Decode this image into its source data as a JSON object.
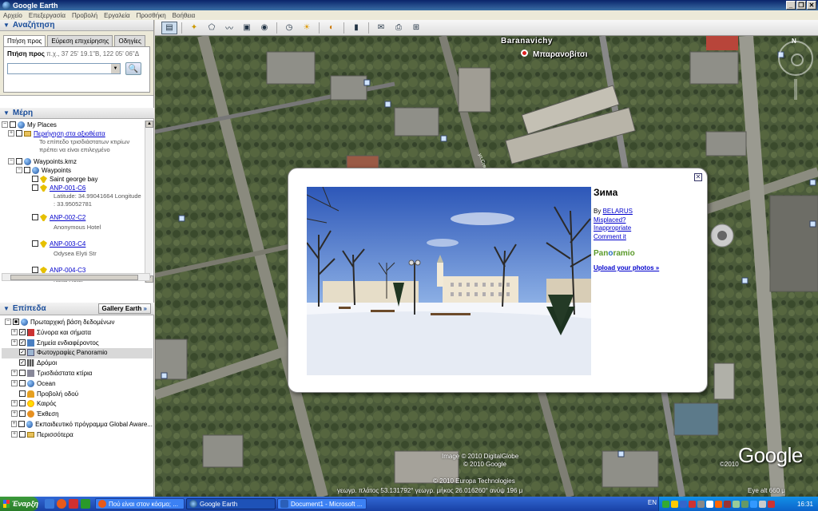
{
  "window": {
    "title": "Google Earth",
    "buttons": [
      "_",
      "❐",
      "✕"
    ]
  },
  "menu": [
    "Αρχείο",
    "Επεξεργασία",
    "Προβολή",
    "Εργαλεία",
    "Προσθήκη",
    "Βοήθεια"
  ],
  "search": {
    "header": "Αναζήτηση",
    "tabs": [
      "Πτήση προς",
      "Εύρεση επιχείρησης",
      "Οδηγίες"
    ],
    "fly_label": "Πτήση προς",
    "fly_hint": "π.χ., 37 25' 19.1\"Β, 122 05' 06\"Δ",
    "input_value": ""
  },
  "places": {
    "header": "Μέρη",
    "items": {
      "my_places": "My Places",
      "tour_link": "Περιήγηση στα αξιοθέατα",
      "tour_desc1": "Το επίπεδο τρισδιάστατων κτιρίων",
      "tour_desc2": "πρέπει να είναι επιλεγμένο",
      "kmz": "Waypoints.kmz",
      "waypoints": "Waypoints",
      "saint_george": "Saint george bay",
      "anp1": "ANP-001-C6",
      "anp1_desc1": "Latitude: 34.99041664 Longitude",
      "anp1_desc2": ": 33.95052781",
      "anp2": "ANP-002-C2",
      "anp2_desc": "Anonymous Hotel",
      "anp3": "ANP-003-C4",
      "anp3_desc": "Odysea Elyti Str",
      "anp4": "ANP-004-C3",
      "anp4_desc": "Nelia Hotel"
    }
  },
  "layers": {
    "header": "Επίπεδα",
    "gallery": "Gallery Earth",
    "items": [
      {
        "label": "Πρωταρχική βάση δεδομένων",
        "icon": "globe",
        "checked": "■",
        "exp": "−",
        "indent": 0
      },
      {
        "label": "Σύνορα και σήματα",
        "icon": "flag",
        "checked": "✓",
        "exp": "+",
        "indent": 1
      },
      {
        "label": "Σημεία ενδιαφέροντος",
        "icon": "blue",
        "checked": "✓",
        "exp": "+",
        "indent": 1
      },
      {
        "label": "Φωτογραφίες Panoramio",
        "icon": "photo",
        "checked": "✓",
        "exp": "",
        "indent": 1
      },
      {
        "label": "Δρόμοι",
        "icon": "road",
        "checked": "✓",
        "exp": "",
        "indent": 1
      },
      {
        "label": "Τρισδιάστατα κτίρια",
        "icon": "building",
        "checked": "",
        "exp": "+",
        "indent": 1
      },
      {
        "label": "Ocean",
        "icon": "globe",
        "checked": "",
        "exp": "+",
        "indent": 1
      },
      {
        "label": "Προβολή οδού",
        "icon": "person",
        "checked": "",
        "exp": "",
        "indent": 1
      },
      {
        "label": "Καιρός",
        "icon": "sun",
        "checked": "",
        "exp": "+",
        "indent": 1
      },
      {
        "label": "Έκθεση",
        "icon": "orange",
        "checked": "",
        "exp": "+",
        "indent": 1
      },
      {
        "label": "Εκπαιδευτικό πρόγραμμα Global Aware...",
        "icon": "globe",
        "checked": "",
        "exp": "+",
        "indent": 1
      },
      {
        "label": "Περισσότερα",
        "icon": "folder",
        "checked": "",
        "exp": "+",
        "indent": 1
      }
    ]
  },
  "map": {
    "city_name_latin": "Baranavichy",
    "city_name_greek": "Μπαρανοβίτσι",
    "street_label": "ул.Советская",
    "copyright1": "Image © 2010 DigitalGlobe",
    "copyright2": "© 2010 Google",
    "copyright3": "© 2010 Europa Technologies",
    "year_badge": "©2010",
    "logo": "Google",
    "coords": "γεωγρ. πλάτος   53.131792°   γεωγρ. μήκος   26.016260°   ανύψ   196 μ",
    "eye_alt": "Eye alt   660 μ"
  },
  "balloon": {
    "title": "Зима",
    "by_label": "By",
    "author": "BELARUS",
    "misplaced": "Misplaced?",
    "inappropriate": "Inappropriate",
    "comment": "Comment it",
    "brand_pre": "Pan",
    "brand_o": "o",
    "brand_post": "ramio",
    "upload": "Upload your photos »",
    "close": "✕"
  },
  "taskbar": {
    "start": "Έναρξη",
    "tasks": [
      "Πού είναι στον κόσμο; ...",
      "Google Earth",
      "Document1 - Microsoft ..."
    ],
    "lang": "EN",
    "clock": "16:31"
  }
}
